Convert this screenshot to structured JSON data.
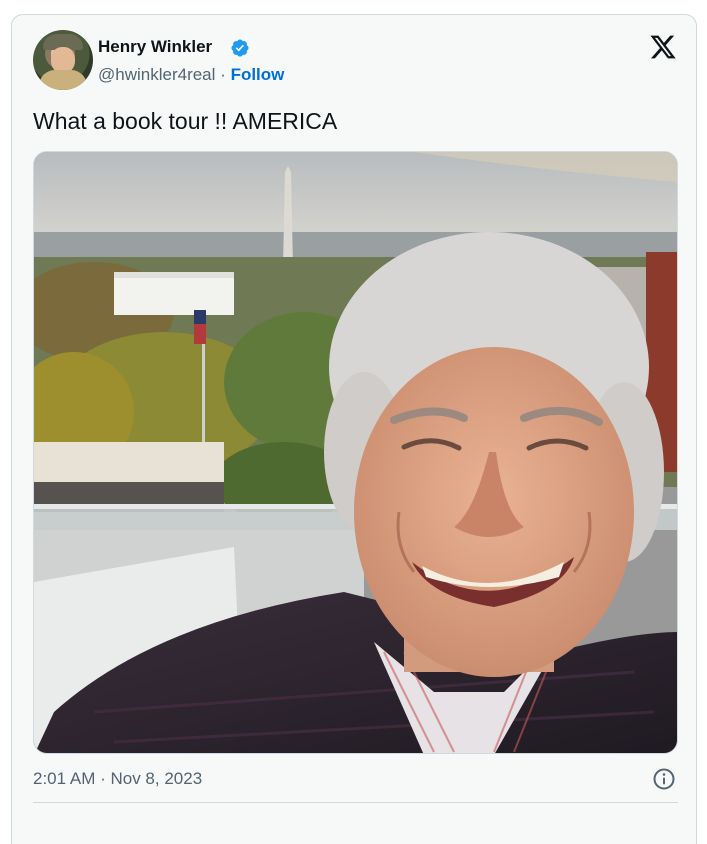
{
  "author": {
    "name": "Henry Winkler",
    "handle": "@hwinkler4real",
    "separator": "·",
    "follow_label": "Follow",
    "verified": true,
    "verified_color": "#1d9bf0"
  },
  "tweet": {
    "text": "What a book tour !! AMERICA",
    "timestamp": "2:01 AM · Nov 8, 2023"
  },
  "icons": {
    "brand": "x-logo-icon",
    "verified": "verified-badge-icon",
    "info": "info-icon"
  },
  "colors": {
    "card_background": "#f7f9f9",
    "border": "#cfd9de",
    "link": "#006fd6",
    "secondary_text": "#536471",
    "primary_text": "#0f1419"
  }
}
